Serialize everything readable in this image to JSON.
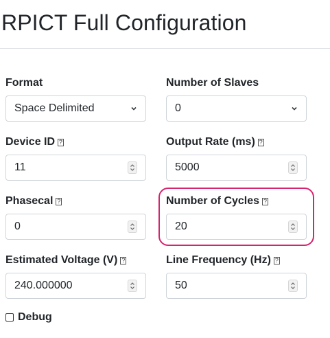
{
  "page": {
    "title": "RPICT Full Configuration"
  },
  "form": {
    "format": {
      "label": "Format",
      "value": "Space Delimited"
    },
    "slaves": {
      "label": "Number of Slaves",
      "value": "0"
    },
    "device_id": {
      "label": "Device ID",
      "value": "11",
      "help": "?"
    },
    "output_rate": {
      "label": "Output Rate (ms)",
      "value": "5000",
      "help": "?"
    },
    "phasecal": {
      "label": "Phasecal",
      "value": "0",
      "help": "?"
    },
    "cycles": {
      "label": "Number of Cycles",
      "value": "20",
      "help": "?"
    },
    "voltage": {
      "label": "Estimated Voltage (V)",
      "value": "240.000000",
      "help": "?"
    },
    "line_freq": {
      "label": "Line Frequency (Hz)",
      "value": "50",
      "help": "?"
    },
    "debug": {
      "label": "Debug",
      "checked": false
    }
  },
  "colors": {
    "highlight": "#d6246e",
    "input_border": "#ced4da"
  },
  "icons": {
    "select": "chevron-down-icon",
    "number": "spinner-icon",
    "help": "help-icon"
  }
}
